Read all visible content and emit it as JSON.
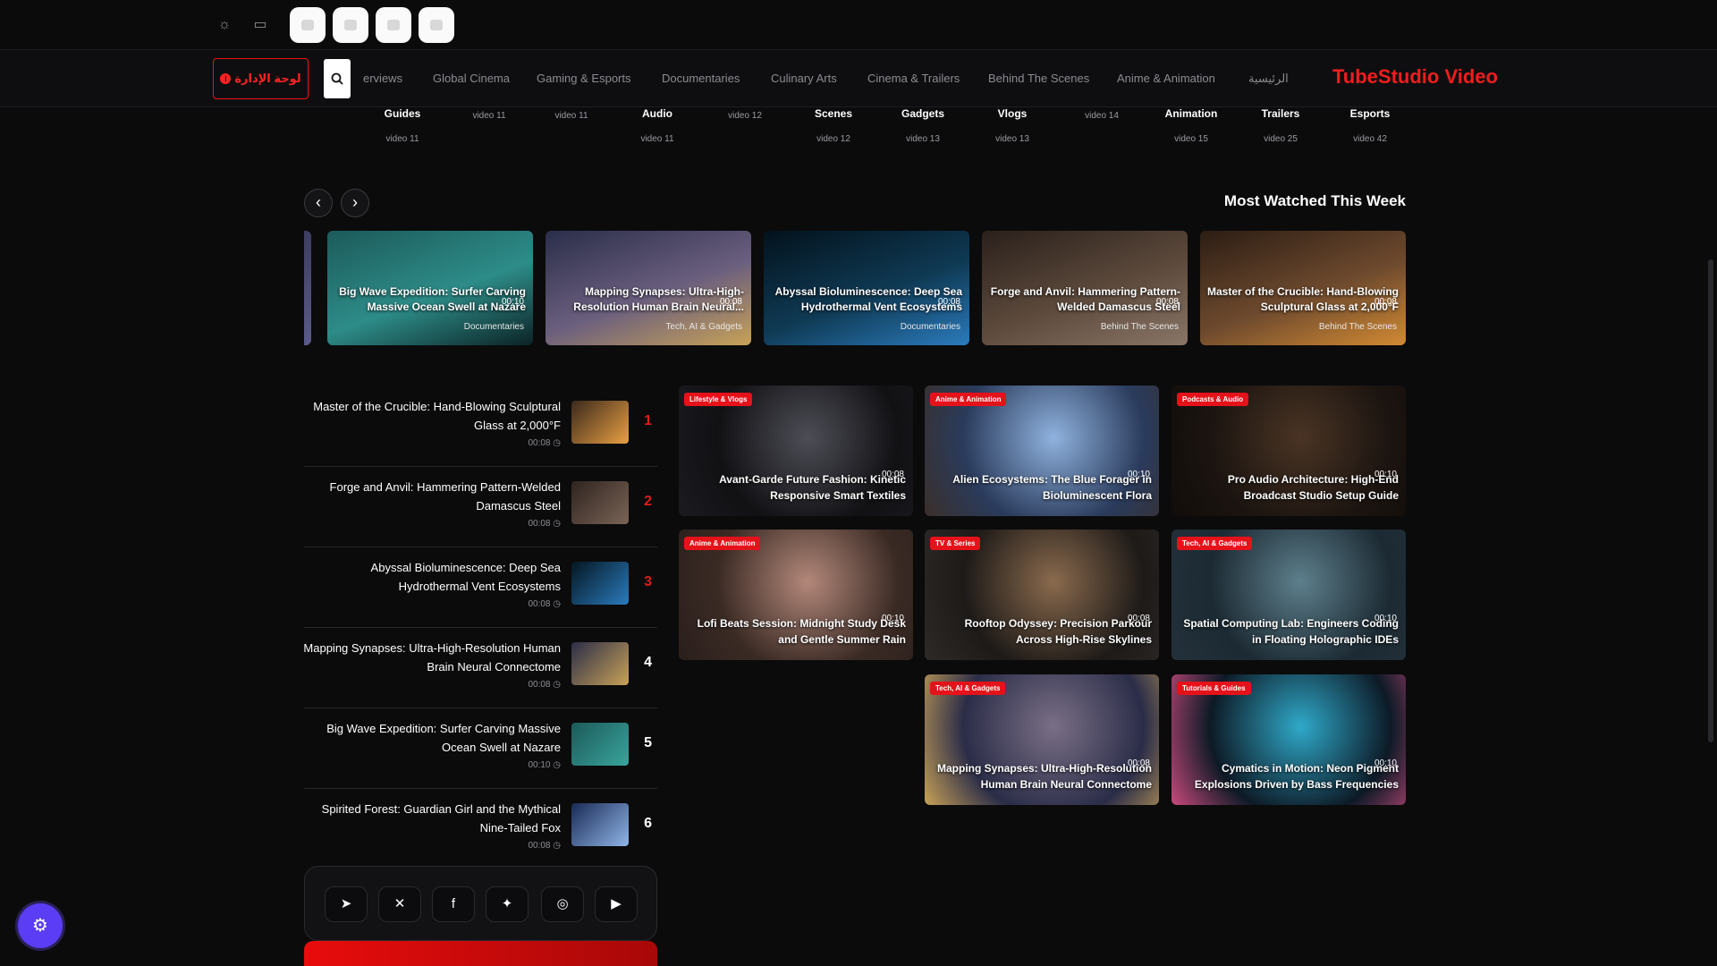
{
  "brand": "TubeStudio Video",
  "admin_button": "لوحة الإدارة",
  "nav": {
    "items": [
      "erviews",
      "Global Cinema",
      "Gaming & Esports",
      "Documentaries",
      "Culinary Arts",
      "Cinema & Trailers",
      "Behind The Scenes",
      "Anime & Animation",
      "الرئيسية"
    ]
  },
  "categories": [
    {
      "name": "Guides",
      "count": "video 11"
    },
    {
      "name": "",
      "count": "video 11"
    },
    {
      "name": "",
      "count": "video 11"
    },
    {
      "name": "Audio",
      "count": "video 11"
    },
    {
      "name": "",
      "count": "video 12"
    },
    {
      "name": "Scenes",
      "count": "video 12"
    },
    {
      "name": "Gadgets",
      "count": "video 13"
    },
    {
      "name": "Vlogs",
      "count": "video 13"
    },
    {
      "name": "",
      "count": "video 14"
    },
    {
      "name": "Animation",
      "count": "video 15"
    },
    {
      "name": "Trailers",
      "count": "video 25"
    },
    {
      "name": "Esports",
      "count": "video 42"
    }
  ],
  "section_title": "Most Watched This Week",
  "carousel": [
    {
      "title": "Big Wave Expedition: Surfer Carving Massive Ocean Swell at Nazare",
      "duration": "00:10",
      "category": "Documentaries",
      "colors": [
        "#1c5a5a",
        "#2d8c88",
        "#0c2326"
      ]
    },
    {
      "title": "Mapping Synapses: Ultra-High-Resolution Human Brain Neural...",
      "duration": "00:08",
      "category": "Tech, AI & Gadgets",
      "colors": [
        "#2a2e4a",
        "#6b5f7e",
        "#c8a257"
      ]
    },
    {
      "title": "Abyssal Bioluminescence: Deep Sea Hydrothermal Vent Ecosystems",
      "duration": "00:08",
      "category": "Documentaries",
      "colors": [
        "#03121c",
        "#0f3a54",
        "#2b7bbd"
      ]
    },
    {
      "title": "Forge and Anvil: Hammering Pattern-Welded Damascus Steel",
      "duration": "00:08",
      "category": "Behind The Scenes",
      "colors": [
        "#2a201b",
        "#5d4a3c",
        "#8a7667"
      ]
    },
    {
      "title": "Master of the Crucible: Hand-Blowing Sculptural Glass at 2,000°F",
      "duration": "00:08",
      "category": "Behind The Scenes",
      "colors": [
        "#2c1d14",
        "#6e4a2e",
        "#d28a32"
      ]
    }
  ],
  "ranked": [
    {
      "rank": "1",
      "title": "Master of the Crucible: Hand-Blowing Sculptural Glass at 2,000°F",
      "duration": "00:08",
      "color": "#e11b1b",
      "thumb": [
        "#3a281c",
        "#e9a043"
      ]
    },
    {
      "rank": "2",
      "title": "Forge and Anvil: Hammering Pattern-Welded Damascus Steel",
      "duration": "00:08",
      "color": "#e11b1b",
      "thumb": [
        "#2f2420",
        "#7a6456"
      ]
    },
    {
      "rank": "3",
      "title": "Abyssal Bioluminescence: Deep Sea Hydrothermal Vent Ecosystems",
      "duration": "00:08",
      "color": "#e11b1b",
      "thumb": [
        "#041621",
        "#2b7bbd"
      ]
    },
    {
      "rank": "4",
      "title": "Mapping Synapses: Ultra-High-Resolution Human Brain Neural Connectome",
      "duration": "00:08",
      "color": "#ffffff",
      "thumb": [
        "#2b2d48",
        "#c8a257"
      ]
    },
    {
      "rank": "5",
      "title": "Big Wave Expedition: Surfer Carving Massive Ocean Swell at Nazare",
      "duration": "00:10",
      "color": "#ffffff",
      "thumb": [
        "#1c5a5a",
        "#39a49c"
      ]
    },
    {
      "rank": "6",
      "title": "Spirited Forest: Guardian Girl and the Mythical Nine-Tailed Fox",
      "duration": "00:08",
      "color": "#ffffff",
      "thumb": [
        "#1a2a55",
        "#8fb6e8"
      ]
    }
  ],
  "grid": [
    {
      "badge": "Lifestyle & Vlogs",
      "title": "Avant-Garde Future Fashion: Kinetic Responsive Smart Textiles",
      "duration": "00:08",
      "colors": [
        "#111114",
        "#4d4d56",
        "#1b1b20"
      ]
    },
    {
      "badge": "Anime & Animation",
      "title": "Alien Ecosystems: The Blue Forager in Bioluminescent Flora",
      "duration": "00:10",
      "colors": [
        "#2a3b5c",
        "#8fb2de",
        "#3a2f2a"
      ]
    },
    {
      "badge": "Podcasts & Audio",
      "title": "Pro Audio Architecture: High-End Broadcast Studio Setup Guide",
      "duration": "00:10",
      "colors": [
        "#1b1410",
        "#4a3424",
        "#120d0a"
      ]
    },
    {
      "badge": "Anime & Animation",
      "title": "Lofi Beats Session: Midnight Study Desk and Gentle Summer Rain",
      "duration": "00:10",
      "colors": [
        "#3a2a24",
        "#b3887a",
        "#2a1f1c"
      ]
    },
    {
      "badge": "TV & Series",
      "title": "Rooftop Odyssey: Precision Parkour Across High-Rise Skylines",
      "duration": "00:08",
      "colors": [
        "#1d1a18",
        "#8a6a4d",
        "#2d2a28"
      ]
    },
    {
      "badge": "Tech, AI & Gadgets",
      "title": "Spatial Computing Lab: Engineers Coding in Floating Holographic IDEs",
      "duration": "00:10",
      "colors": [
        "#1c2a33",
        "#5d7f8c",
        "#24313a"
      ]
    },
    {
      "badge": "Tech, AI & Gadgets",
      "title": "Mapping Synapses: Ultra-High-Resolution Human Brain Neural Connectome",
      "duration": "00:08",
      "colors": [
        "#2b2d48",
        "#7a6f86",
        "#c8a257"
      ]
    },
    {
      "badge": "Tutorials & Guides",
      "title": "Cymatics in Motion: Neon Pigment Explosions Driven by Bass Frequencies",
      "duration": "00:10",
      "colors": [
        "#0d1a26",
        "#2fa9c9",
        "#c94a7c"
      ]
    }
  ],
  "footer_social": [
    "telegram-icon",
    "x-icon",
    "facebook-icon",
    "twitter-icon",
    "instagram-icon",
    "youtube-icon"
  ],
  "accent_color": "#e5121a"
}
